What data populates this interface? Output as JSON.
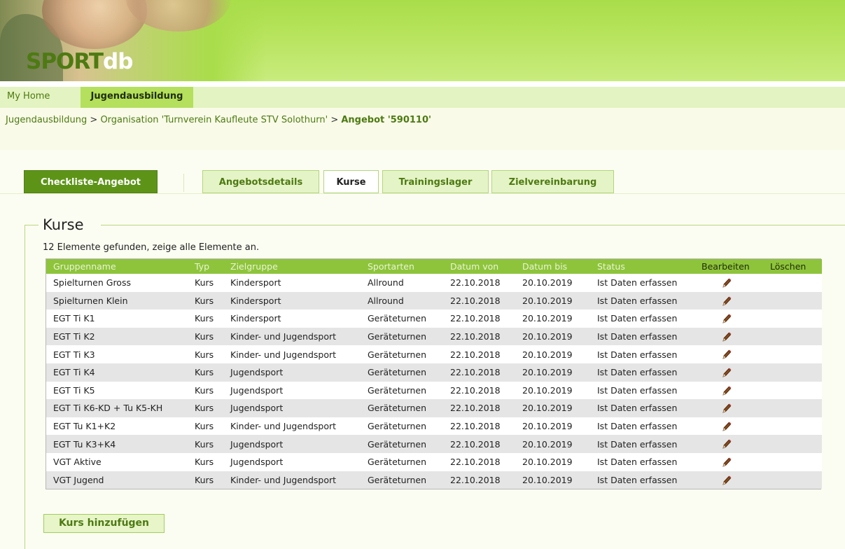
{
  "app": {
    "logo_sport": "SPORT",
    "logo_db": "db"
  },
  "topnav": {
    "home": "My Home",
    "jugend": "Jugendausbildung"
  },
  "breadcrumb": {
    "part1": "Jugendausbildung",
    "sep": ">",
    "part2": "Organisation 'Turnverein Kaufleute STV Solothurn'",
    "current": "Angebot '590110'"
  },
  "tabs": {
    "checkliste": "Checkliste-Angebot",
    "angebotsdetails": "Angebotsdetails",
    "kurse": "Kurse",
    "trainingslager": "Trainingslager",
    "zielvereinbarung": "Zielvereinbarung"
  },
  "section": {
    "legend": "Kurse",
    "summary": "12 Elemente gefunden, zeige alle Elemente an."
  },
  "table": {
    "headers": {
      "gruppenname": "Gruppenname",
      "typ": "Typ",
      "zielgruppe": "Zielgruppe",
      "sportarten": "Sportarten",
      "datum_von": "Datum von",
      "datum_bis": "Datum bis",
      "status": "Status",
      "bearbeiten": "Bearbeiten",
      "loeschen": "Löschen"
    },
    "rows": [
      {
        "name": "Spielturnen Gross",
        "typ": "Kurs",
        "ziel": "Kindersport",
        "sport": "Allround",
        "von": "22.10.2018",
        "bis": "20.10.2019",
        "status": "Ist Daten erfassen"
      },
      {
        "name": "Spielturnen Klein",
        "typ": "Kurs",
        "ziel": "Kindersport",
        "sport": "Allround",
        "von": "22.10.2018",
        "bis": "20.10.2019",
        "status": "Ist Daten erfassen"
      },
      {
        "name": "EGT Ti K1",
        "typ": "Kurs",
        "ziel": "Kindersport",
        "sport": "Geräteturnen",
        "von": "22.10.2018",
        "bis": "20.10.2019",
        "status": "Ist Daten erfassen"
      },
      {
        "name": "EGT Ti K2",
        "typ": "Kurs",
        "ziel": "Kinder- und Jugendsport",
        "sport": "Geräteturnen",
        "von": "22.10.2018",
        "bis": "20.10.2019",
        "status": "Ist Daten erfassen"
      },
      {
        "name": "EGT Ti K3",
        "typ": "Kurs",
        "ziel": "Kinder- und Jugendsport",
        "sport": "Geräteturnen",
        "von": "22.10.2018",
        "bis": "20.10.2019",
        "status": "Ist Daten erfassen"
      },
      {
        "name": "EGT Ti K4",
        "typ": "Kurs",
        "ziel": "Jugendsport",
        "sport": "Geräteturnen",
        "von": "22.10.2018",
        "bis": "20.10.2019",
        "status": "Ist Daten erfassen"
      },
      {
        "name": "EGT Ti K5",
        "typ": "Kurs",
        "ziel": "Jugendsport",
        "sport": "Geräteturnen",
        "von": "22.10.2018",
        "bis": "20.10.2019",
        "status": "Ist Daten erfassen"
      },
      {
        "name": "EGT Ti K6-KD + Tu K5-KH",
        "typ": "Kurs",
        "ziel": "Jugendsport",
        "sport": "Geräteturnen",
        "von": "22.10.2018",
        "bis": "20.10.2019",
        "status": "Ist Daten erfassen"
      },
      {
        "name": "EGT Tu K1+K2",
        "typ": "Kurs",
        "ziel": "Kinder- und Jugendsport",
        "sport": "Geräteturnen",
        "von": "22.10.2018",
        "bis": "20.10.2019",
        "status": "Ist Daten erfassen"
      },
      {
        "name": "EGT Tu K3+K4",
        "typ": "Kurs",
        "ziel": "Jugendsport",
        "sport": "Geräteturnen",
        "von": "22.10.2018",
        "bis": "20.10.2019",
        "status": "Ist Daten erfassen"
      },
      {
        "name": "VGT Aktive",
        "typ": "Kurs",
        "ziel": "Jugendsport",
        "sport": "Geräteturnen",
        "von": "22.10.2018",
        "bis": "20.10.2019",
        "status": "Ist Daten erfassen"
      },
      {
        "name": "VGT Jugend",
        "typ": "Kurs",
        "ziel": "Kinder- und Jugendsport",
        "sport": "Geräteturnen",
        "von": "22.10.2018",
        "bis": "20.10.2019",
        "status": "Ist Daten erfassen"
      }
    ],
    "edit_icon": "pencil-icon"
  },
  "actions": {
    "add": "Kurs hinzufügen"
  },
  "colors": {
    "brand_green": "#5d9418",
    "header_green": "#8ec43c",
    "link_green": "#4d7a12"
  }
}
